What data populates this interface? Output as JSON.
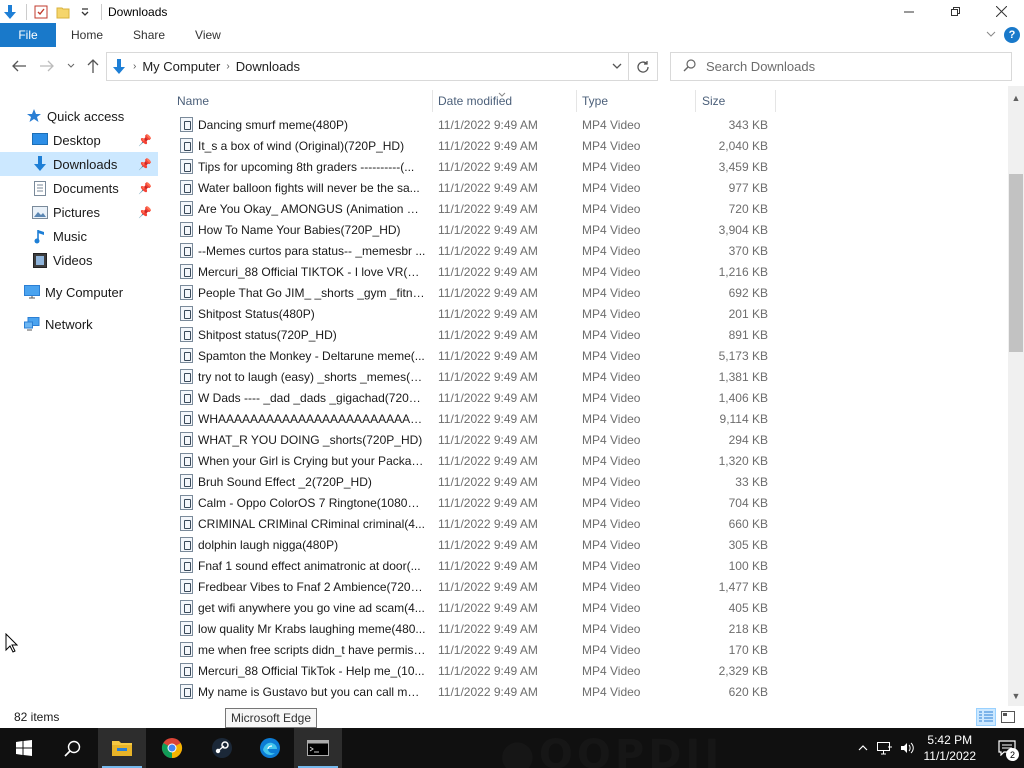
{
  "window": {
    "title": "Downloads",
    "quick_access_toolbar": [
      "down-arrow-icon",
      "properties-icon",
      "new-folder-icon",
      "customize-dropdown-icon"
    ],
    "controls": [
      "minimize",
      "maximize",
      "close"
    ]
  },
  "ribbon": {
    "file_tab": "File",
    "tabs": [
      "Home",
      "Share",
      "View"
    ]
  },
  "address_bar": {
    "crumbs": [
      "My Computer",
      "Downloads"
    ]
  },
  "search": {
    "placeholder": "Search Downloads"
  },
  "nav_pane": {
    "items": [
      {
        "label": "Quick access",
        "icon": "star-icon",
        "pinned": false,
        "selected": false
      },
      {
        "label": "Desktop",
        "icon": "desktop-icon",
        "pinned": true,
        "selected": false
      },
      {
        "label": "Downloads",
        "icon": "download-icon",
        "pinned": true,
        "selected": true
      },
      {
        "label": "Documents",
        "icon": "documents-icon",
        "pinned": true,
        "selected": false
      },
      {
        "label": "Pictures",
        "icon": "pictures-icon",
        "pinned": true,
        "selected": false
      },
      {
        "label": "Music",
        "icon": "music-icon",
        "pinned": false,
        "selected": false
      },
      {
        "label": "Videos",
        "icon": "videos-icon",
        "pinned": false,
        "selected": false
      },
      {
        "label": "My Computer",
        "icon": "computer-icon",
        "pinned": false,
        "selected": false
      },
      {
        "label": "Network",
        "icon": "network-icon",
        "pinned": false,
        "selected": false
      }
    ]
  },
  "columns": {
    "name": "Name",
    "date": "Date modified",
    "type": "Type",
    "size": "Size"
  },
  "files": [
    {
      "name": "Dancing smurf meme(480P)",
      "date": "11/1/2022 9:49 AM",
      "type": "MP4 Video",
      "size": "343 KB"
    },
    {
      "name": "It_s a box of wind (Original)(720P_HD)",
      "date": "11/1/2022 9:49 AM",
      "type": "MP4 Video",
      "size": "2,040 KB"
    },
    {
      "name": "Tips for upcoming 8th graders ----------(...",
      "date": "11/1/2022 9:49 AM",
      "type": "MP4 Video",
      "size": "3,459 KB"
    },
    {
      "name": "Water balloon fights will never be the sa...",
      "date": "11/1/2022 9:49 AM",
      "type": "MP4 Video",
      "size": "977 KB"
    },
    {
      "name": "Are You Okay_ AMONGUS (Animation M...",
      "date": "11/1/2022 9:49 AM",
      "type": "MP4 Video",
      "size": "720 KB"
    },
    {
      "name": "How To Name Your Babies(720P_HD)",
      "date": "11/1/2022 9:49 AM",
      "type": "MP4 Video",
      "size": "3,904 KB"
    },
    {
      "name": "--Memes curtos para status-- _memesbr ...",
      "date": "11/1/2022 9:49 AM",
      "type": "MP4 Video",
      "size": "370 KB"
    },
    {
      "name": "Mercuri_88 Official TIKTOK - I love VR(108...",
      "date": "11/1/2022 9:49 AM",
      "type": "MP4 Video",
      "size": "1,216 KB"
    },
    {
      "name": "People That Go JIM_ _shorts _gym _fitnes...",
      "date": "11/1/2022 9:49 AM",
      "type": "MP4 Video",
      "size": "692 KB"
    },
    {
      "name": "Shitpost Status(480P)",
      "date": "11/1/2022 9:49 AM",
      "type": "MP4 Video",
      "size": "201 KB"
    },
    {
      "name": "Shitpost status(720P_HD)",
      "date": "11/1/2022 9:49 AM",
      "type": "MP4 Video",
      "size": "891 KB"
    },
    {
      "name": "Spamton the Monkey - Deltarune meme(...",
      "date": "11/1/2022 9:49 AM",
      "type": "MP4 Video",
      "size": "5,173 KB"
    },
    {
      "name": "try not to laugh (easy) _shorts _memes(7...",
      "date": "11/1/2022 9:49 AM",
      "type": "MP4 Video",
      "size": "1,381 KB"
    },
    {
      "name": "W Dads ---- _dad _dads _gigachad(720P_...",
      "date": "11/1/2022 9:49 AM",
      "type": "MP4 Video",
      "size": "1,406 KB"
    },
    {
      "name": "WHAAAAAAAAAAAAAAAAAAAAAAAAAA...",
      "date": "11/1/2022 9:49 AM",
      "type": "MP4 Video",
      "size": "9,114 KB"
    },
    {
      "name": "WHAT_R YOU DOING _shorts(720P_HD)",
      "date": "11/1/2022 9:49 AM",
      "type": "MP4 Video",
      "size": "294 KB"
    },
    {
      "name": "When your Girl is Crying but your Packag...",
      "date": "11/1/2022 9:49 AM",
      "type": "MP4 Video",
      "size": "1,320 KB"
    },
    {
      "name": "Bruh Sound Effect _2(720P_HD)",
      "date": "11/1/2022 9:49 AM",
      "type": "MP4 Video",
      "size": "33 KB"
    },
    {
      "name": "Calm - Oppo ColorOS 7 Ringtone(1080P_...",
      "date": "11/1/2022 9:49 AM",
      "type": "MP4 Video",
      "size": "704 KB"
    },
    {
      "name": "CRIMINAL CRIMinal CRiminal criminal(4...",
      "date": "11/1/2022 9:49 AM",
      "type": "MP4 Video",
      "size": "660 KB"
    },
    {
      "name": "dolphin laugh nigga(480P)",
      "date": "11/1/2022 9:49 AM",
      "type": "MP4 Video",
      "size": "305 KB"
    },
    {
      "name": "Fnaf 1 sound effect animatronic at door(...",
      "date": "11/1/2022 9:49 AM",
      "type": "MP4 Video",
      "size": "100 KB"
    },
    {
      "name": "Fredbear Vibes to Fnaf 2 Ambience(720P_...",
      "date": "11/1/2022 9:49 AM",
      "type": "MP4 Video",
      "size": "1,477 KB"
    },
    {
      "name": "get wifi anywhere you go vine ad scam(4...",
      "date": "11/1/2022 9:49 AM",
      "type": "MP4 Video",
      "size": "405 KB"
    },
    {
      "name": "low quality Mr Krabs laughing meme(480...",
      "date": "11/1/2022 9:49 AM",
      "type": "MP4 Video",
      "size": "218 KB"
    },
    {
      "name": "me when free scripts didn_t have permiss...",
      "date": "11/1/2022 9:49 AM",
      "type": "MP4 Video",
      "size": "170 KB"
    },
    {
      "name": "Mercuri_88 Official TikTok - Help me_(10...",
      "date": "11/1/2022 9:49 AM",
      "type": "MP4 Video",
      "size": "2,329 KB"
    },
    {
      "name": "My name is Gustavo but you can call me ...",
      "date": "11/1/2022 9:49 AM",
      "type": "MP4 Video",
      "size": "620 KB"
    }
  ],
  "status": {
    "item_count": "82 items"
  },
  "tooltip": "Microsoft Edge",
  "taskbar": {
    "apps": [
      "start-icon",
      "search-icon",
      "file-explorer-icon",
      "chrome-icon",
      "steam-icon",
      "edge-icon",
      "terminal-icon"
    ],
    "clock_time": "5:42 PM",
    "clock_date": "11/1/2022",
    "notification_count": "2"
  },
  "colors": {
    "accent": "#1979ca",
    "selection": "#cce8ff",
    "header_text": "#4c607a",
    "taskbar": "#101010"
  }
}
